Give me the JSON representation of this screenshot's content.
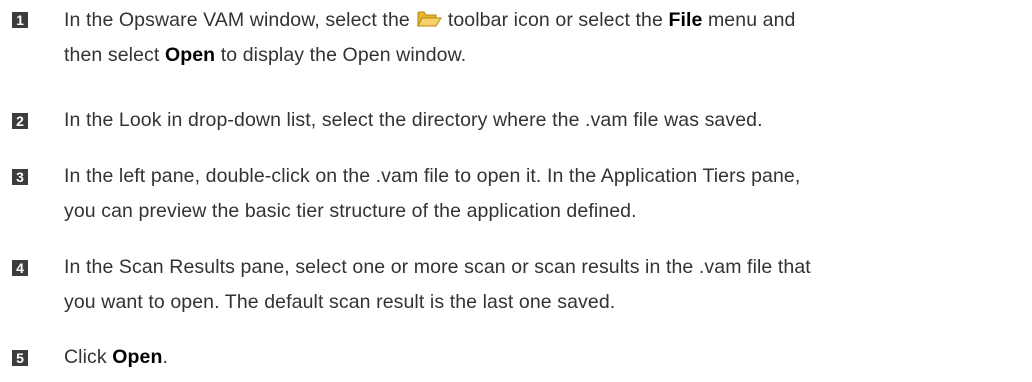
{
  "steps": [
    {
      "number": "1",
      "line1_a": "In the Opsware VAM window, select the",
      "line1_b": "toolbar icon or select the",
      "line1_bold1": "File",
      "line1_c": "menu and",
      "line2_a": "then select",
      "line2_bold": "Open",
      "line2_b": "to display the Open window.",
      "icon": "folder-open-icon"
    },
    {
      "number": "2",
      "text": "In the Look in drop-down list, select the directory where the .vam file was saved."
    },
    {
      "number": "3",
      "line1": "In the left pane, double-click on the .vam file to open it. In the Application Tiers pane,",
      "line2": "you can preview the basic tier structure of the application defined."
    },
    {
      "number": "4",
      "line1": "In the Scan Results pane, select one or more scan or scan results in the .vam file that",
      "line2": "you want to open. The default scan result is the last one saved."
    },
    {
      "number": "5",
      "text_a": "Click",
      "text_bold": "Open",
      "text_b": "."
    }
  ],
  "colors": {
    "badge_bg": "#3c3c3c",
    "text": "#333333",
    "folder_fill": "#f2c23a",
    "folder_stroke": "#b8860b"
  }
}
